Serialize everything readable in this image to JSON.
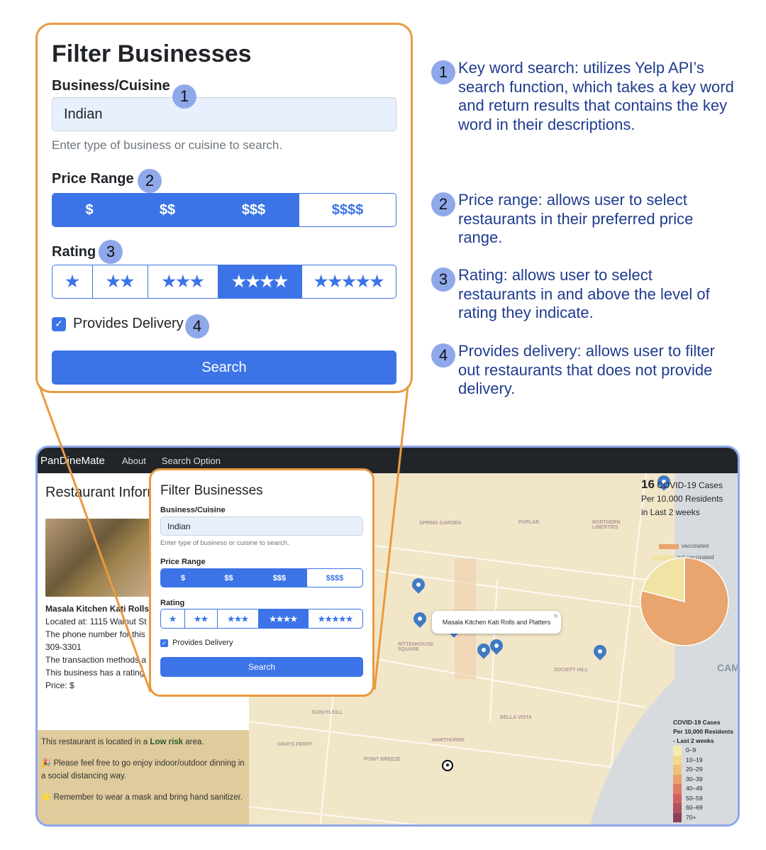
{
  "filter": {
    "title": "Filter Businesses",
    "business_label": "Business/Cuisine",
    "business_value": "Indian",
    "business_help": "Enter type of business or cuisine to search.",
    "price_label": "Price Range",
    "price_options": [
      "$",
      "$$",
      "$$$",
      "$$$$"
    ],
    "price_selected": [
      0,
      1,
      2
    ],
    "rating_label": "Rating",
    "rating_options": [
      "★",
      "★★",
      "★★★",
      "★★★★",
      "★★★★★"
    ],
    "rating_selected": 3,
    "delivery_label": "Provides Delivery",
    "delivery_checked": true,
    "search_label": "Search"
  },
  "markers": [
    "1",
    "2",
    "3",
    "4"
  ],
  "notes": [
    {
      "num": "1",
      "text": "Key word search: utilizes Yelp API’s search function, which takes a key word and return results that contains the key word in their descriptions."
    },
    {
      "num": "2",
      "text": "Price range: allows user to select restaurants in their preferred price range."
    },
    {
      "num": "3",
      "text": "Rating: allows user to select restaurants in and above the level of rating they indicate."
    },
    {
      "num": "4",
      "text": "Provides delivery: allows user to filter out restaurants that does not provide delivery."
    }
  ],
  "app": {
    "brand": "PanDineMate",
    "nav": [
      "About",
      "Search Option"
    ],
    "info_title": "Restaurant Information",
    "restaurant_name": "Masala Kitchen Kati Rolls",
    "info_lines": [
      "Located at: 1115 Walnut St",
      "The phone number for this",
      "309-3301",
      "The transaction methods a",
      "This business has a rating",
      "Price: $"
    ],
    "risk_prefix": "This restaurant is located in a ",
    "risk_level": "Low risk",
    "risk_suffix": " area.",
    "tip1": "🎉 Please feel free to go enjoy indoor/outdoor dinning in a social distancing way.",
    "tip2": "⭐ Remember to wear a mask and bring hand sanitizer."
  },
  "map": {
    "cases_count": "16",
    "cases_line1": "COVID-19 Cases",
    "cases_line2": "Per 10,000 Residents",
    "cases_line3": "in Last 2 weeks",
    "popup": "Masala Kitchen Kati Rolls and Platters",
    "popup_close": "×",
    "labels": [
      "SPRING GARDEN",
      "POPLAR",
      "NORTHERN LIBERTIES",
      "RITTENHOUSE SQUARE",
      "SOCIETY HILL",
      "SCHUYLKILL",
      "BELLA VISTA",
      "GRAYS FERRY",
      "POINT BREEZE",
      "HAWTHORNE",
      "CAM"
    ],
    "pie": {
      "legend": [
        "vaccinated",
        "not vaccinated"
      ],
      "colors": [
        "#e8a56e",
        "#f1e3a4"
      ],
      "fractions": [
        0.79,
        0.21
      ]
    },
    "legend_title": [
      "COVID-19 Cases",
      "Per 10,000 Residents",
      "- Last 2 weeks"
    ],
    "legend_bins": [
      "0–9",
      "10–19",
      "20–29",
      "30–39",
      "40–49",
      "50–59",
      "60–69",
      "70+"
    ],
    "legend_colors": [
      "#f7ebb0",
      "#f3d88e",
      "#eec07c",
      "#e8a06e",
      "#df7d62",
      "#cf6160",
      "#b24f5e",
      "#8e3f5a"
    ]
  }
}
